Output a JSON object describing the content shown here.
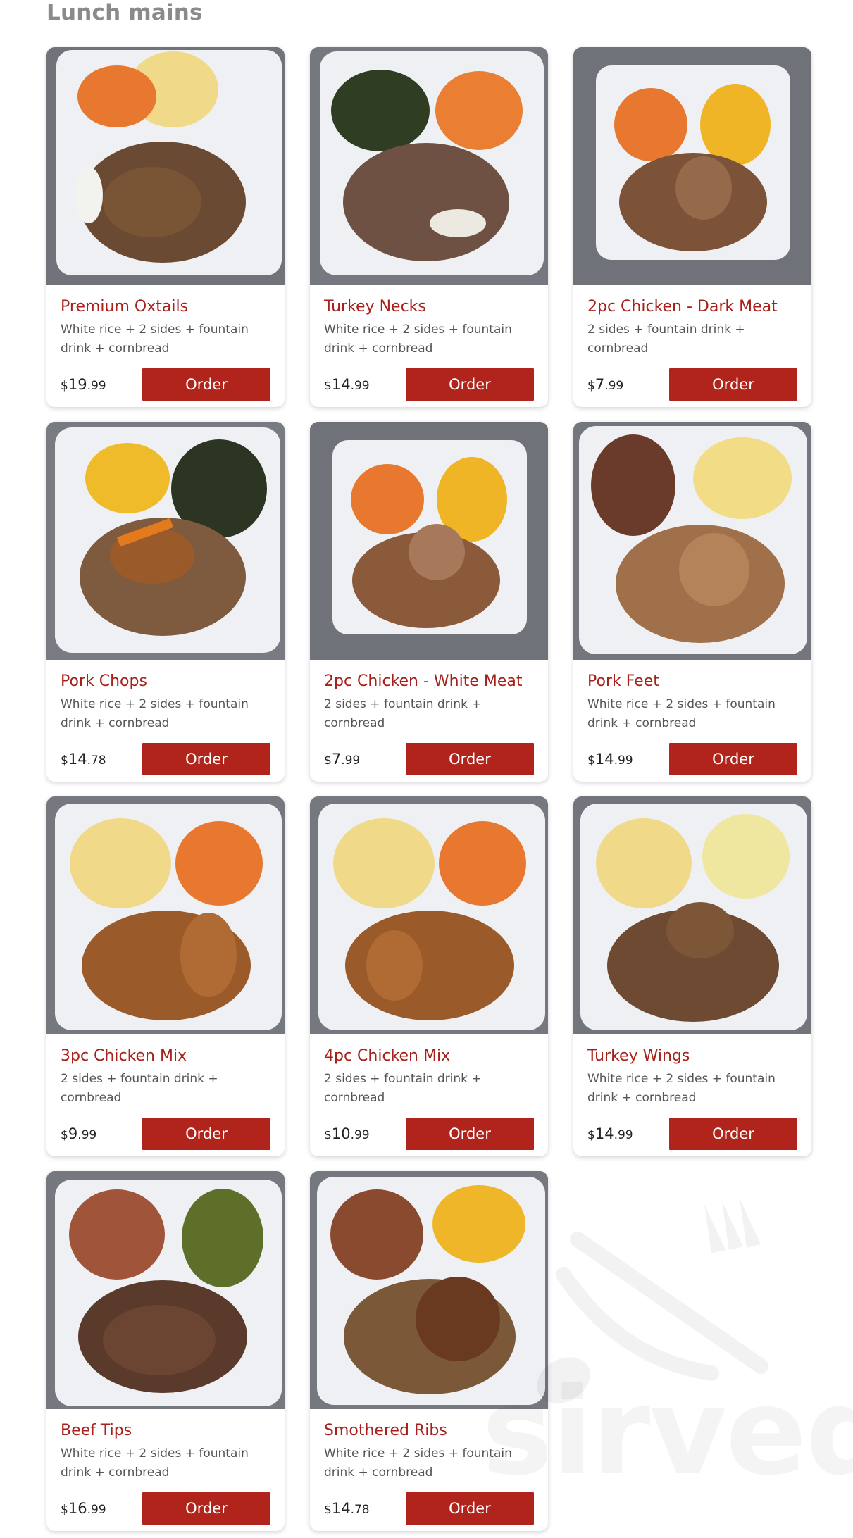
{
  "section": {
    "title": "Lunch mains"
  },
  "order_label": "Order",
  "accent_color": "#b0241c",
  "items": [
    {
      "name": "Premium Oxtails",
      "desc": "White rice + 2 sides + fountain drink + cornbread",
      "currency": "$",
      "dollars": "19",
      "cents": ".99"
    },
    {
      "name": "Turkey Necks",
      "desc": "White rice + 2 sides + fountain drink + cornbread",
      "currency": "$",
      "dollars": "14",
      "cents": ".99"
    },
    {
      "name": "2pc Chicken - Dark Meat",
      "desc": "2 sides + fountain drink + cornbread",
      "currency": "$",
      "dollars": "7",
      "cents": ".99"
    },
    {
      "name": "Pork Chops",
      "desc": "White rice + 2 sides + fountain drink + cornbread",
      "currency": "$",
      "dollars": "14",
      "cents": ".78"
    },
    {
      "name": "2pc Chicken - White Meat",
      "desc": "2 sides + fountain drink + cornbread",
      "currency": "$",
      "dollars": "7",
      "cents": ".99"
    },
    {
      "name": "Pork Feet",
      "desc": "White rice + 2 sides + fountain drink + cornbread",
      "currency": "$",
      "dollars": "14",
      "cents": ".99"
    },
    {
      "name": "3pc Chicken Mix",
      "desc": "2 sides + fountain drink + cornbread",
      "currency": "$",
      "dollars": "9",
      "cents": ".99"
    },
    {
      "name": "4pc Chicken Mix",
      "desc": "2 sides + fountain drink + cornbread",
      "currency": "$",
      "dollars": "10",
      "cents": ".99"
    },
    {
      "name": "Turkey Wings",
      "desc": "White rice + 2 sides + fountain drink + cornbread",
      "currency": "$",
      "dollars": "14",
      "cents": ".99"
    },
    {
      "name": "Beef Tips",
      "desc": "White rice + 2 sides + fountain drink + cornbread",
      "currency": "$",
      "dollars": "16",
      "cents": ".99"
    },
    {
      "name": "Smothered Ribs",
      "desc": "White rice + 2 sides + fountain drink + cornbread",
      "currency": "$",
      "dollars": "14",
      "cents": ".78"
    }
  ],
  "watermark": {
    "text": "sirved",
    "icon": "fork-spoon-icon"
  }
}
